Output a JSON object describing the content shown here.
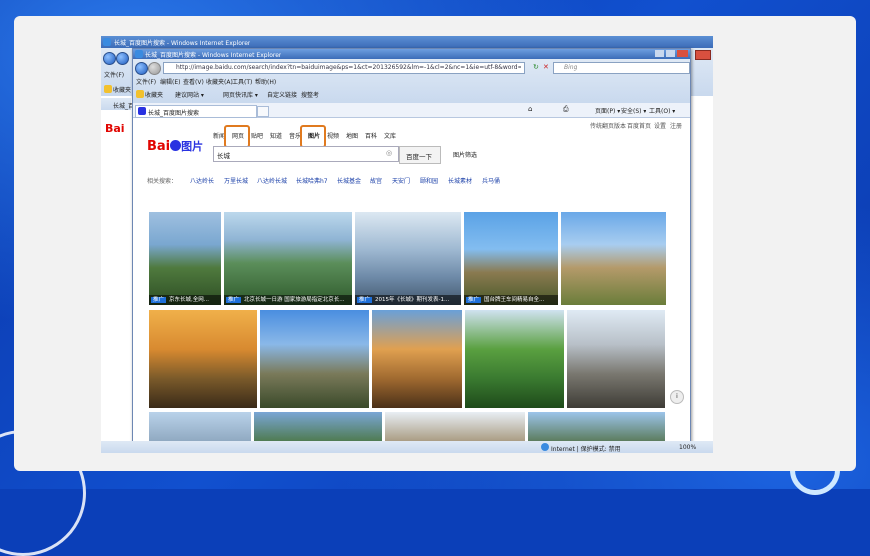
{
  "outer_window": {
    "title": "长城_百度图片搜索 - Windows Internet Explorer",
    "menu_file": "文件(F)",
    "fav": "收藏夹",
    "tab_fragment": "长城_百",
    "baidu_logo_fragment": "Bai"
  },
  "inner_window": {
    "title": "长城_百度图片搜索 - Windows Internet Explorer",
    "url": "http://image.baidu.com/search/index?tn=baiduimage&ps=1&ct=201326592&lm=-1&cl=2&nc=1&ie=utf-8&word=%E9%95%BF%E5%9F",
    "search_engine": "Bing",
    "menu": [
      "文件(F)",
      "编辑(E)",
      "查看(V)",
      "收藏夹(A)",
      "工具(T)",
      "帮助(H)"
    ],
    "fav_bar": [
      "收藏夹",
      "建议网站 ▾",
      "网页快讯库 ▾",
      "自定义链接",
      "搜整考"
    ],
    "tab_title": "长城_百度图片搜索",
    "cmd_bar": [
      "页面(P) ▾",
      "安全(S) ▾",
      "工具(O) ▾"
    ],
    "status_done": "完成",
    "status_zone": "Internet | 保护模式: 禁用",
    "zoom": "100%"
  },
  "baidu": {
    "top_right": [
      "传统翻页版本",
      "百度首页",
      "设置",
      "注册",
      "登录"
    ],
    "logo_text": "Bai",
    "logo_cn": "图片",
    "nav": [
      "新闻",
      "网页",
      "贴吧",
      "知道",
      "音乐",
      "图片",
      "视频",
      "地图",
      "百科",
      "文库"
    ],
    "query": "长城",
    "search_button": "百度一下",
    "filter": "图片筛选",
    "related_label": "相关搜索：",
    "related": [
      "八达岭长",
      "万里长城",
      "八达岭长城",
      "长城哈弗h7",
      "长城基金",
      "故宫",
      "天安门",
      "颐和园",
      "长城素材",
      "兵马俑"
    ],
    "captions": [
      {
        "tag": "推广",
        "text": "京东长城,全网..."
      },
      {
        "tag": "推广",
        "text": "北京长城一日游 国家旅游局指定北京长..."
      },
      {
        "tag": "推广",
        "text": "2015年《长城》期刊发表-1..."
      },
      {
        "tag": "推广",
        "text": "国台牌王车间精易自全..."
      }
    ]
  },
  "colors": {
    "baidu_blue": "#2932e1",
    "baidu_red": "#e10602",
    "highlight": "#e07a1f"
  },
  "icons": [
    "back-arrow-icon",
    "forward-arrow-icon",
    "refresh-icon",
    "stop-icon",
    "search-icon",
    "home-icon",
    "print-icon",
    "camera-icon"
  ]
}
